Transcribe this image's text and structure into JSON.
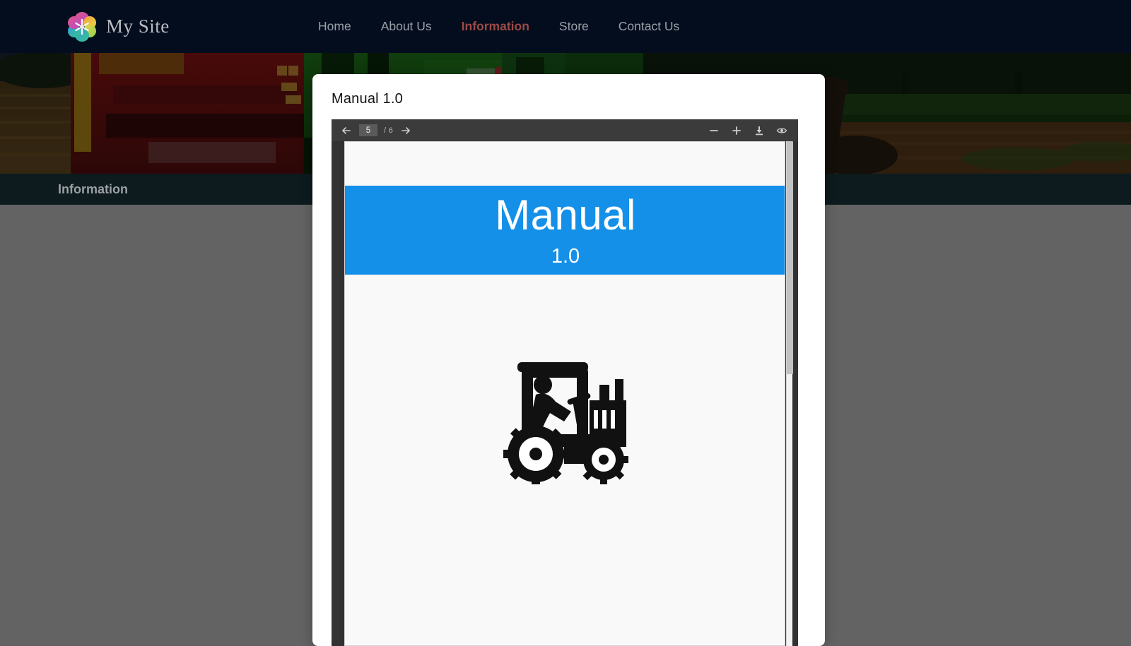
{
  "header": {
    "brand_name": "My Site",
    "logo_icon": "flower-hex-logo-icon",
    "nav": [
      {
        "label": "Home",
        "active": false
      },
      {
        "label": "About Us",
        "active": false
      },
      {
        "label": "Information",
        "active": true
      },
      {
        "label": "Store",
        "active": false
      },
      {
        "label": "Contact Us",
        "active": false
      }
    ]
  },
  "hero": {
    "alt": "farm field with red potato harvester and green Fendt tractor"
  },
  "section_bar": {
    "title": "Information"
  },
  "modal": {
    "title": "Manual 1.0"
  },
  "pdf_viewer": {
    "toolbar": {
      "prev_icon": "arrow-left-icon",
      "next_icon": "arrow-right-icon",
      "page_value": "5",
      "page_count": "/ 6",
      "zoom_out_icon": "minus-icon",
      "zoom_in_icon": "plus-icon",
      "download_icon": "download-icon",
      "view_icon": "eye-icon"
    },
    "page": {
      "doc_title": "Manual",
      "doc_version": "1.0",
      "illustration": "tractor-icon",
      "banner_color": "#1490e8"
    }
  },
  "colors": {
    "header_bg": "#030d1e",
    "nav_active": "#9c4a45",
    "info_bar_bg": "#0d1b1e",
    "page_bg": "#636363",
    "accent_blue": "#1490e8",
    "toolbar_bg": "#3b3b3b",
    "viewer_frame": "#323232"
  }
}
